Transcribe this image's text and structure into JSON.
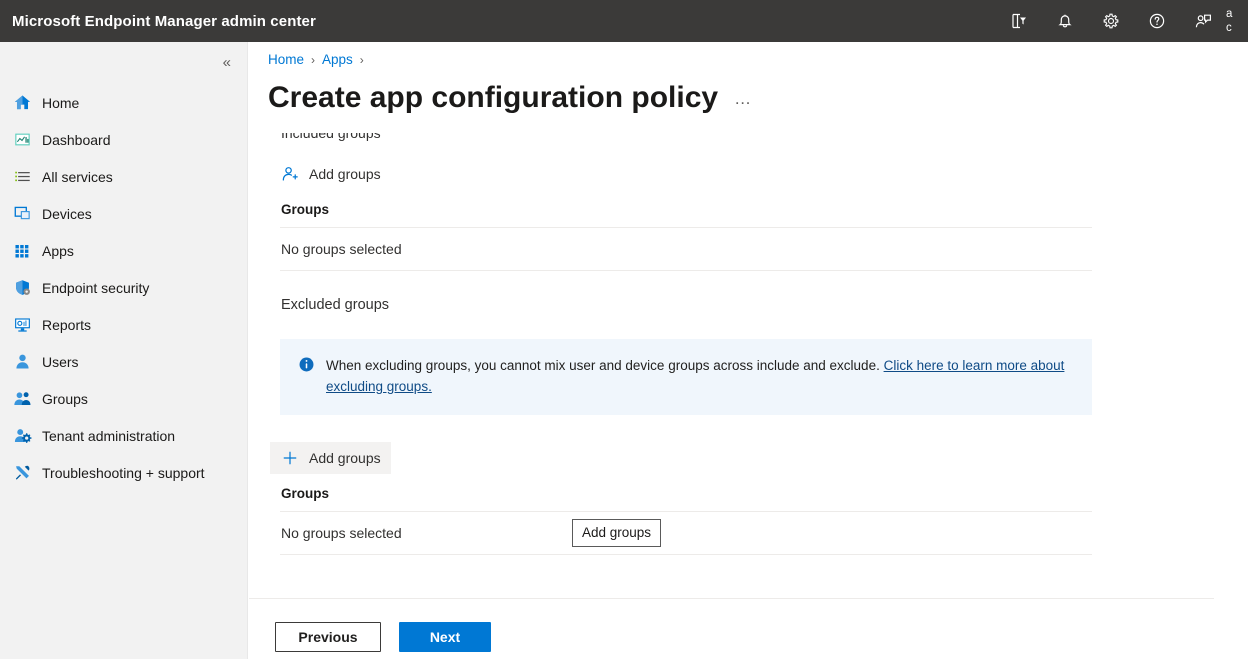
{
  "topbar": {
    "title": "Microsoft Endpoint Manager admin center",
    "icons": [
      {
        "name": "directory-filter-icon",
        "label": "Directories + subscriptions"
      },
      {
        "name": "notifications-bell-icon",
        "label": "Notifications"
      },
      {
        "name": "settings-gear-icon",
        "label": "Settings"
      },
      {
        "name": "help-question-icon",
        "label": "Help"
      },
      {
        "name": "feedback-icon",
        "label": "Feedback"
      }
    ],
    "account_line1": "a",
    "account_line2": "c"
  },
  "sidebar": {
    "collapse_glyph": "«",
    "items": [
      {
        "label": "Home",
        "icon": "home-icon"
      },
      {
        "label": "Dashboard",
        "icon": "dashboard-icon"
      },
      {
        "label": "All services",
        "icon": "all-services-icon"
      },
      {
        "label": "Devices",
        "icon": "devices-icon"
      },
      {
        "label": "Apps",
        "icon": "apps-grid-icon"
      },
      {
        "label": "Endpoint security",
        "icon": "shield-icon"
      },
      {
        "label": "Reports",
        "icon": "reports-icon"
      },
      {
        "label": "Users",
        "icon": "user-icon"
      },
      {
        "label": "Groups",
        "icon": "groups-icon"
      },
      {
        "label": "Tenant administration",
        "icon": "tenant-admin-icon"
      },
      {
        "label": "Troubleshooting + support",
        "icon": "troubleshooting-icon"
      }
    ]
  },
  "breadcrumb": {
    "items": [
      "Home",
      "Apps"
    ],
    "separator": "›"
  },
  "page": {
    "title": "Create app configuration policy",
    "ellipsis": "…"
  },
  "content": {
    "clipped_top_text": "Included groups",
    "included": {
      "add_button_label": "Add groups",
      "add_button_icon": "add-user-icon",
      "table_header": "Groups",
      "empty_text": "No groups selected"
    },
    "excluded": {
      "section_label": "Excluded groups",
      "info_icon": "info-circle-icon",
      "info_text": "When excluding groups, you cannot mix user and device groups across include and exclude. ",
      "info_link_text": "Click here to learn more about excluding groups.",
      "add_button_label": "Add groups",
      "add_button_icon": "plus-icon",
      "tooltip_text": "Add groups",
      "table_header": "Groups",
      "empty_text": "No groups selected"
    }
  },
  "footer": {
    "previous_label": "Previous",
    "next_label": "Next"
  },
  "colors": {
    "topbar_bg": "#3b3a39",
    "sidebar_bg": "#f2f2f2",
    "accent_blue": "#0078d4",
    "link_blue": "#0f4b86",
    "info_bg": "#f0f6fc",
    "divider": "#edebe9",
    "hover_bg": "#f3f2f1"
  }
}
